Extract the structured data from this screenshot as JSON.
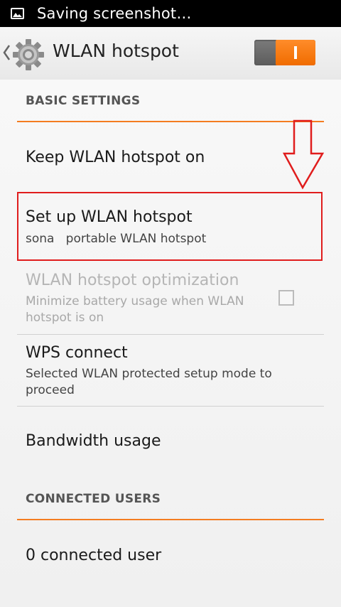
{
  "status_bar": {
    "text": "Saving screenshot…",
    "icon": "image-icon"
  },
  "action_bar": {
    "title": "WLAN hotspot",
    "icon": "settings-gear-icon",
    "toggle_on": true
  },
  "sections": {
    "basic": {
      "header": "BASIC SETTINGS",
      "keep_on": {
        "title": "Keep WLAN hotspot on"
      },
      "setup": {
        "title": "Set up WLAN hotspot",
        "subtitle": "sona   portable WLAN hotspot"
      },
      "optimization": {
        "title": "WLAN hotspot optimization",
        "subtitle": "Minimize battery usage when WLAN hotspot is on",
        "checked": false
      },
      "wps": {
        "title": "WPS connect",
        "subtitle": "Selected WLAN protected setup mode to proceed"
      },
      "bandwidth": {
        "title": "Bandwidth usage"
      }
    },
    "connected": {
      "header": "CONNECTED USERS",
      "count": {
        "title": "0 connected user"
      }
    }
  },
  "colors": {
    "accent": "#f47c20",
    "highlight": "#e01d1d"
  }
}
